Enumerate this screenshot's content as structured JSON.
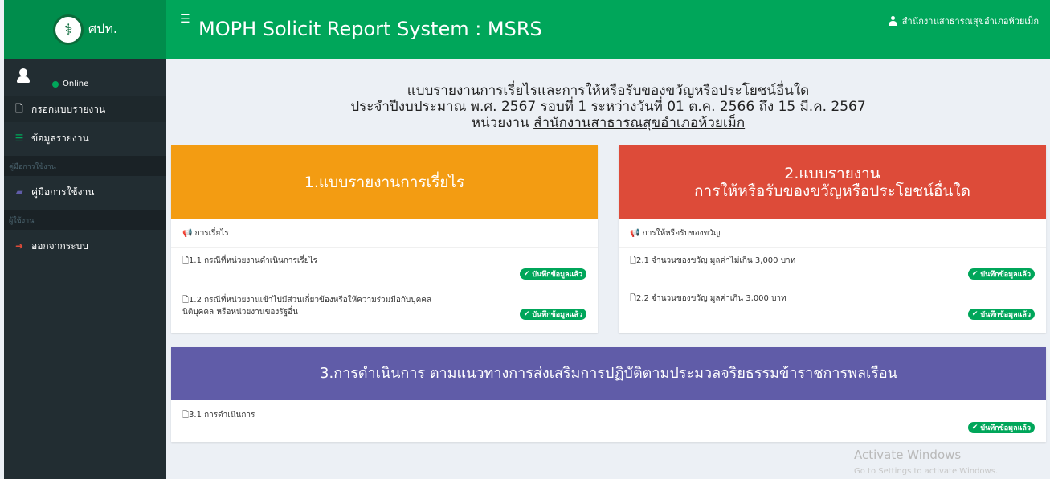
{
  "header": {
    "logo_text": "ศปท.",
    "menu_icon": "hamburger-icon",
    "title": "MOPH Solicit Report System : MSRS",
    "user_name": "สำนักงานสาธารณสุขอำเภอห้วยเม็ก"
  },
  "sidebar": {
    "status": "Online",
    "items": [
      {
        "label": "กรอกแบบรายงาน",
        "icon": "file-icon"
      },
      {
        "label": "ข้อมูลรายงาน",
        "icon": "list-icon"
      }
    ],
    "header_manual": "คู่มือการใช้งาน",
    "manual_item": {
      "label": "คู่มือการใช้งาน",
      "icon": "book-icon"
    },
    "header_user": "ผู้ใช้งาน",
    "logout_item": {
      "label": "ออกจากระบบ",
      "icon": "sign-out-icon"
    }
  },
  "heading": {
    "line1": "แบบรายงานการเรี่ยไรและการให้หรือรับของขวัญหรือประโยชน์อื่นใด",
    "line2": "ประจำปีงบประมาณ พ.ศ. 2567 รอบที่ 1 ระหว่างวันที่ 01 ต.ค. 2566 ถึง 15 มี.ค. 2567",
    "line3_prefix": "หน่วยงาน",
    "line3_agency": "สำนักงานสาธารณสุขอำเภอห้วยเม็ก"
  },
  "box1": {
    "title": "1.แบบรายงานการเรี่ยไร",
    "color": "#f39c12",
    "section": "การเรี่ยไร",
    "rows": [
      {
        "text": "1.1 กรณีที่หน่วยงานดำเนินการเรี่ยไร",
        "badge": "บันทึกข้อมูลแล้ว"
      },
      {
        "text_line1": "1.2 กรณีที่หน่วยงานเข้าไปมีส่วนเกี่ยวข้องหรือให้ความร่วมมือกับบุคคล",
        "text_line2": "นิติบุคคล หรือหน่วยงานของรัฐอื่น",
        "badge": "บันทึกข้อมูลแล้ว"
      }
    ]
  },
  "box2": {
    "title_line1": "2.แบบรายงาน",
    "title_line2": "การให้หรือรับของขวัญหรือประโยชน์อื่นใด",
    "color": "#dd4b39",
    "section": "การให้หรือรับของขวัญ",
    "rows": [
      {
        "text": "2.1 จำนวนของขวัญ มูลค่าไม่เกิน 3,000 บาท",
        "badge": "บันทึกข้อมูลแล้ว"
      },
      {
        "text": "2.2 จำนวนของขวัญ มูลค่าเกิน 3,000 บาท",
        "badge": "บันทึกข้อมูลแล้ว"
      }
    ]
  },
  "box3": {
    "title": "3.การดำเนินการ ตามแนวทางการส่งเสริมการปฏิบัติตามประมวลจริยธรรมข้าราชการพลเรือน",
    "color": "#605ca8",
    "rows": [
      {
        "text": "3.1 การดำเนินการ",
        "badge": "บันทึกข้อมูลแล้ว"
      }
    ]
  },
  "watermark": {
    "line1": "Activate Windows",
    "line2": "Go to Settings to activate Windows."
  }
}
